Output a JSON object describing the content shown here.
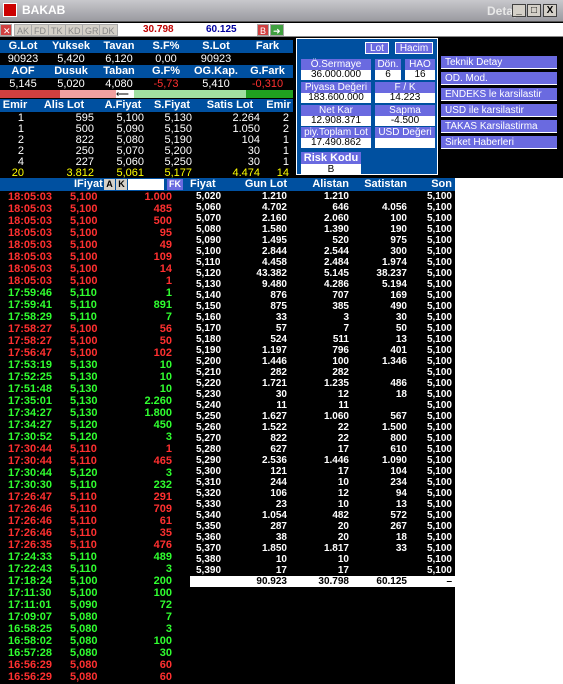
{
  "window": {
    "title": "BAKAB",
    "subtitle": "Detay",
    "min": "_",
    "max": "□",
    "close": "X"
  },
  "toolbar": {
    "buttons": [
      "AK",
      "FD",
      "TK",
      "KD",
      "GR",
      "DK"
    ],
    "val1": "30.798",
    "val2": "60.125",
    "b_label": "B"
  },
  "summary": {
    "row1_headers": [
      "G.Lot",
      "Yuksek",
      "Tavan",
      "S.F%",
      "S.Lot",
      "Fark"
    ],
    "row1_values": [
      "90923",
      "5,420",
      "6,120",
      "0,00",
      "90923",
      ""
    ],
    "row2_headers": [
      "AOF",
      "Dusuk",
      "Taban",
      "G.F%",
      "OG.Kap.",
      "G.Fark"
    ],
    "row2_values": [
      "5,145",
      "5,020",
      "4,080",
      "-5,73",
      "5,410",
      "-0,310"
    ]
  },
  "depth": {
    "headers": [
      "Emir",
      "Alis Lot",
      "A.Fiyat",
      "S.Fiyat",
      "Satis Lot",
      "Emir"
    ],
    "rows": [
      [
        "1",
        "595",
        "5,100",
        "5,130",
        "2.264",
        "2"
      ],
      [
        "1",
        "500",
        "5,090",
        "5,150",
        "1.050",
        "2"
      ],
      [
        "2",
        "822",
        "5,080",
        "5,190",
        "104",
        "1"
      ],
      [
        "2",
        "250",
        "5,070",
        "5,200",
        "30",
        "1"
      ],
      [
        "4",
        "227",
        "5,060",
        "5,250",
        "30",
        "1"
      ],
      [
        "20",
        "3.812",
        "5,061",
        "5,177",
        "4.474",
        "14"
      ]
    ]
  },
  "panel": {
    "btn_lot": "Lot",
    "btn_hacim": "Hacim",
    "o_sermaye_label": "Ö.Sermaye",
    "o_sermaye": "36.000.000",
    "don_label": "Dön.",
    "don": "6",
    "hao_label": "HAO",
    "hao": "16",
    "piyasa_label": "Piyasa Değeri",
    "piyasa": "183.600.000",
    "fk_label": "F / K",
    "fk": "14.223",
    "netkar_label": "Net Kar",
    "netkar": "12.908.371",
    "sapma_label": "Sapma",
    "sapma": "-4.500",
    "ptoplam_label": "piy.Toplam Lot",
    "ptoplam": "17.490.862",
    "usd_label": "USD Değeri",
    "risk_label": "Risk Kodu",
    "risk": "B"
  },
  "menu": [
    "Teknik Detay",
    "OD. Mod.",
    "ENDEKS le karsilastir",
    "USD ile karsilastir",
    "TAKAS Karsilastirma",
    "Sirket Haberleri"
  ],
  "trades": {
    "headers": {
      "fiyat": "IFiyat",
      "a": "A",
      "k": "K",
      "fk": "FK"
    },
    "rows": [
      [
        "18:05:03",
        "5,100",
        "1.000",
        "r"
      ],
      [
        "18:05:03",
        "5,100",
        "485",
        "r"
      ],
      [
        "18:05:03",
        "5,100",
        "500",
        "r"
      ],
      [
        "18:05:03",
        "5,100",
        "95",
        "r"
      ],
      [
        "18:05:03",
        "5,100",
        "49",
        "r"
      ],
      [
        "18:05:03",
        "5,100",
        "109",
        "r"
      ],
      [
        "18:05:03",
        "5,100",
        "14",
        "r"
      ],
      [
        "18:05:03",
        "5,100",
        "1",
        "r"
      ],
      [
        "17:59:46",
        "5,110",
        "1",
        "g"
      ],
      [
        "17:59:41",
        "5,110",
        "891",
        "g"
      ],
      [
        "17:58:29",
        "5,110",
        "7",
        "g"
      ],
      [
        "17:58:27",
        "5,100",
        "56",
        "r"
      ],
      [
        "17:58:27",
        "5,100",
        "50",
        "r"
      ],
      [
        "17:56:47",
        "5,100",
        "102",
        "r"
      ],
      [
        "17:53:19",
        "5,130",
        "10",
        "g"
      ],
      [
        "17:52:25",
        "5,130",
        "10",
        "g"
      ],
      [
        "17:51:48",
        "5,130",
        "10",
        "g"
      ],
      [
        "17:35:01",
        "5,130",
        "2.260",
        "g"
      ],
      [
        "17:34:27",
        "5,130",
        "1.800",
        "g"
      ],
      [
        "17:34:27",
        "5,120",
        "450",
        "g"
      ],
      [
        "17:30:52",
        "5,120",
        "3",
        "g"
      ],
      [
        "17:30:44",
        "5,110",
        "1",
        "r"
      ],
      [
        "17:30:44",
        "5,110",
        "465",
        "r"
      ],
      [
        "17:30:44",
        "5,120",
        "3",
        "g"
      ],
      [
        "17:30:30",
        "5,110",
        "232",
        "g"
      ],
      [
        "17:26:47",
        "5,110",
        "291",
        "r"
      ],
      [
        "17:26:46",
        "5,110",
        "709",
        "r"
      ],
      [
        "17:26:46",
        "5,110",
        "61",
        "r"
      ],
      [
        "17:26:46",
        "5,110",
        "35",
        "r"
      ],
      [
        "17:26:35",
        "5,110",
        "476",
        "r"
      ],
      [
        "17:24:33",
        "5,110",
        "489",
        "g"
      ],
      [
        "17:22:43",
        "5,110",
        "3",
        "g"
      ],
      [
        "17:18:24",
        "5,100",
        "200",
        "g"
      ],
      [
        "17:11:30",
        "5,100",
        "100",
        "g"
      ],
      [
        "17:11:01",
        "5,090",
        "72",
        "g"
      ],
      [
        "17:09:07",
        "5,080",
        "7",
        "g"
      ],
      [
        "16:58:25",
        "5,080",
        "3",
        "g"
      ],
      [
        "16:58:02",
        "5,080",
        "100",
        "g"
      ],
      [
        "16:57:28",
        "5,080",
        "30",
        "g"
      ],
      [
        "16:56:29",
        "5,080",
        "60",
        "r"
      ],
      [
        "16:56:29",
        "5,080",
        "60",
        "r"
      ]
    ]
  },
  "prices": {
    "headers": [
      "Fiyat",
      "Gun Lot",
      "Alistan",
      "Satistan",
      "Son"
    ],
    "rows": [
      [
        "5,020",
        "1.210",
        "1.210",
        "",
        "5,100"
      ],
      [
        "5,060",
        "4.702",
        "646",
        "4.056",
        "5,100"
      ],
      [
        "5,070",
        "2.160",
        "2.060",
        "100",
        "5,100"
      ],
      [
        "5,080",
        "1.580",
        "1.390",
        "190",
        "5,100"
      ],
      [
        "5,090",
        "1.495",
        "520",
        "975",
        "5,100"
      ],
      [
        "5,100",
        "2.844",
        "2.544",
        "300",
        "5,100"
      ],
      [
        "5,110",
        "4.458",
        "2.484",
        "1.974",
        "5,100"
      ],
      [
        "5,120",
        "43.382",
        "5.145",
        "38.237",
        "5,100"
      ],
      [
        "5,130",
        "9.480",
        "4.286",
        "5.194",
        "5,100"
      ],
      [
        "5,140",
        "876",
        "707",
        "169",
        "5,100"
      ],
      [
        "5,150",
        "875",
        "385",
        "490",
        "5,100"
      ],
      [
        "5,160",
        "33",
        "3",
        "30",
        "5,100"
      ],
      [
        "5,170",
        "57",
        "7",
        "50",
        "5,100"
      ],
      [
        "5,180",
        "524",
        "511",
        "13",
        "5,100"
      ],
      [
        "5,190",
        "1.197",
        "796",
        "401",
        "5,100"
      ],
      [
        "5,200",
        "1.446",
        "100",
        "1.346",
        "5,100"
      ],
      [
        "5,210",
        "282",
        "282",
        "",
        "5,100"
      ],
      [
        "5,220",
        "1.721",
        "1.235",
        "486",
        "5,100"
      ],
      [
        "5,230",
        "30",
        "12",
        "18",
        "5,100"
      ],
      [
        "5,240",
        "11",
        "11",
        "",
        "5,100"
      ],
      [
        "5,250",
        "1.627",
        "1.060",
        "567",
        "5,100"
      ],
      [
        "5,260",
        "1.522",
        "22",
        "1.500",
        "5,100"
      ],
      [
        "5,270",
        "822",
        "22",
        "800",
        "5,100"
      ],
      [
        "5,280",
        "627",
        "17",
        "610",
        "5,100"
      ],
      [
        "5,290",
        "2.536",
        "1.446",
        "1.090",
        "5,100"
      ],
      [
        "5,300",
        "121",
        "17",
        "104",
        "5,100"
      ],
      [
        "5,310",
        "244",
        "10",
        "234",
        "5,100"
      ],
      [
        "5,320",
        "106",
        "12",
        "94",
        "5,100"
      ],
      [
        "5,330",
        "23",
        "10",
        "13",
        "5,100"
      ],
      [
        "5,340",
        "1.054",
        "482",
        "572",
        "5,100"
      ],
      [
        "5,350",
        "287",
        "20",
        "267",
        "5,100"
      ],
      [
        "5,360",
        "38",
        "20",
        "18",
        "5,100"
      ],
      [
        "5,370",
        "1.850",
        "1.817",
        "33",
        "5,100"
      ],
      [
        "5,380",
        "10",
        "10",
        "",
        "5,100"
      ],
      [
        "5,390",
        "17",
        "17",
        "",
        "5,100"
      ]
    ],
    "totals": [
      "90.923",
      "30.798",
      "60.125"
    ]
  },
  "colors": {
    "red": "#ff3030",
    "green": "#30ff30",
    "yellow": "#ffff00",
    "header_blue": "#0050a0",
    "menu": "#6a6ae0"
  }
}
